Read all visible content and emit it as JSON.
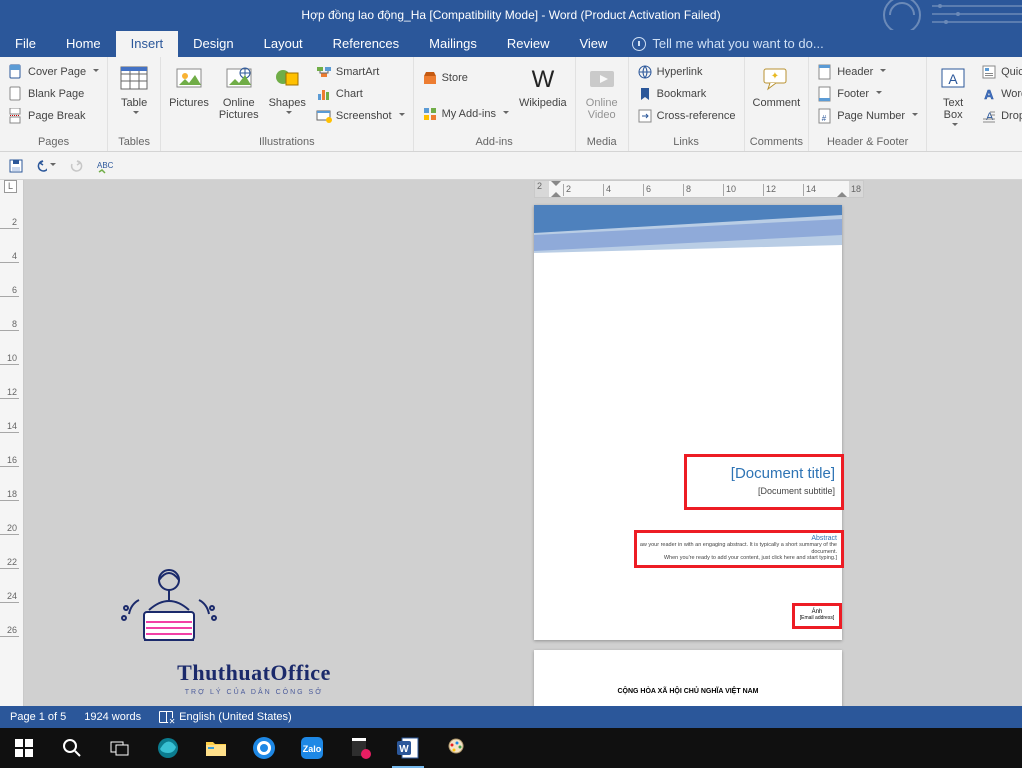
{
  "title": "Hợp đồng lao động_Ha [Compatibility Mode] - Word (Product Activation Failed)",
  "tabs": {
    "file": "File",
    "home": "Home",
    "insert": "Insert",
    "design": "Design",
    "layout": "Layout",
    "references": "References",
    "mailings": "Mailings",
    "review": "Review",
    "view": "View",
    "tell": "Tell me what you want to do..."
  },
  "ribbon": {
    "pages": {
      "cover": "Cover Page",
      "blank": "Blank Page",
      "break": "Page Break",
      "label": "Pages"
    },
    "tables": {
      "table": "Table",
      "label": "Tables"
    },
    "illus": {
      "pictures": "Pictures",
      "online": "Online\nPictures",
      "shapes": "Shapes",
      "smart": "SmartArt",
      "chart": "Chart",
      "screenshot": "Screenshot",
      "label": "Illustrations"
    },
    "addins": {
      "store": "Store",
      "my": "My Add-ins",
      "wiki": "Wikipedia",
      "label": "Add-ins"
    },
    "media": {
      "video": "Online\nVideo",
      "label": "Media"
    },
    "links": {
      "hyper": "Hyperlink",
      "bookmark": "Bookmark",
      "cross": "Cross-reference",
      "label": "Links"
    },
    "comments": {
      "comment": "Comment",
      "label": "Comments"
    },
    "hf": {
      "header": "Header",
      "footer": "Footer",
      "pagenum": "Page Number",
      "label": "Header & Footer"
    },
    "text": {
      "textbox": "Text\nBox",
      "quick": "Quick",
      "word": "Word",
      "drop": "Drop"
    }
  },
  "hruler": [
    "2",
    "2",
    "4",
    "6",
    "8",
    "10",
    "12",
    "14",
    "18"
  ],
  "vruler": [
    "2",
    "4",
    "6",
    "8",
    "10",
    "12",
    "14",
    "16",
    "18",
    "20",
    "22",
    "24",
    "26"
  ],
  "cover": {
    "title": "[Document title]",
    "subtitle": "[Document subtitle]",
    "abshead": "Abstract",
    "abs1": "aw your reader in with an engaging abstract. It is typically a short summary of the",
    "abs2": "document.",
    "abs3": "When you're ready to add your content, just click here and start typing.]",
    "author": "Ánh",
    "email": "[Email address]"
  },
  "page2head": "CỘNG HÒA XÃ HỘI CHỦ NGHĨA VIỆT NAM",
  "wm": {
    "main": "ThuthuatOffice",
    "sub": "TRỢ LÝ CỦA DÂN CÔNG SỞ"
  },
  "status": {
    "page": "Page 1 of 5",
    "words": "1924 words",
    "lang": "English (United States)"
  }
}
